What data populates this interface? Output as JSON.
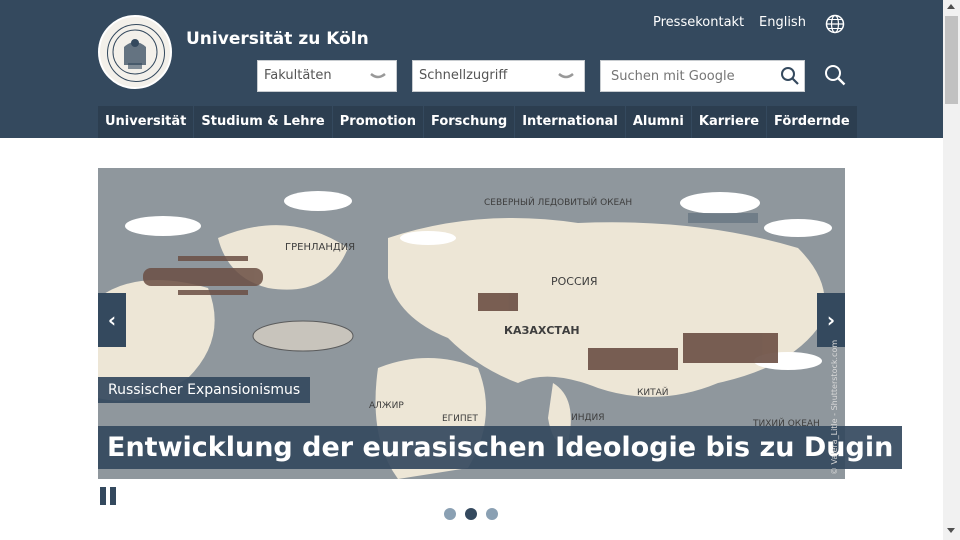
{
  "header": {
    "title": "Universität zu Köln",
    "top_links": [
      "Pressekontakt",
      "English"
    ],
    "language_icon": "globe-icon"
  },
  "quicknav": {
    "faculties_label": "Fakultäten",
    "quick_access_label": "Schnellzugriff",
    "search_placeholder": "Suchen mit Google"
  },
  "nav": {
    "items": [
      "Universität",
      "Studium & Lehre",
      "Promotion",
      "Forschung",
      "International",
      "Alumni",
      "Karriere",
      "Fördernde"
    ]
  },
  "slider": {
    "kicker": "Russischer Expansionismus",
    "headline": "Entwicklung der eurasischen Ideologie bis zu Dugin",
    "credit": "© Valera_Litle - Shutterstock.com",
    "prev_label": "‹",
    "next_label": "›",
    "total_slides": 3,
    "active_slide": 2,
    "map_labels": [
      "СЕВЕРНЫЙ ЛЕДОВИТЫЙ ОКЕАН",
      "ГРЕНЛАНДИЯ",
      "РОССИЯ",
      "КАЗАХСТАН",
      "КИТАЙ",
      "ТИХИЙ ОКЕАН",
      "АЛЖИР",
      "ЕГИПЕТ",
      "ИНДИЯ"
    ]
  },
  "colors": {
    "primary": "#34495e",
    "nav_item": "#2c3e50",
    "dot_inactive": "#8aa0b3"
  }
}
